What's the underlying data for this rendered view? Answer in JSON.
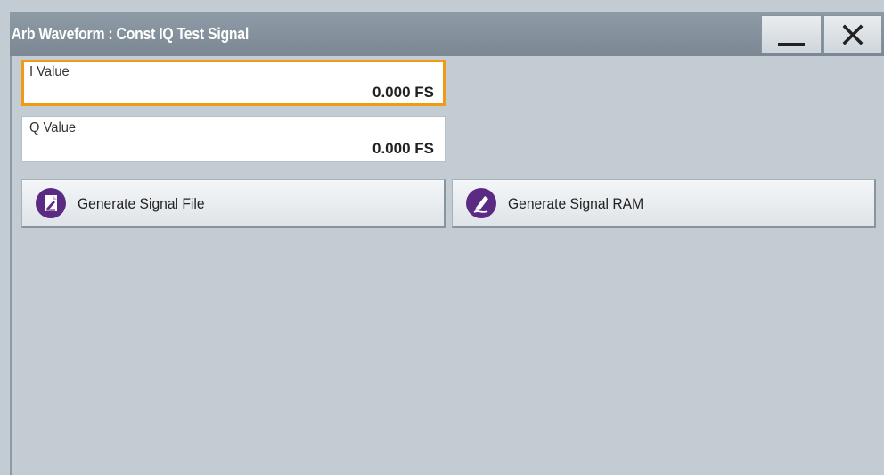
{
  "window": {
    "title": "Arb Waveform : Const IQ Test Signal"
  },
  "fields": {
    "i_value": {
      "label": "I Value",
      "value": "0.000 FS"
    },
    "q_value": {
      "label": "Q Value",
      "value": "0.000 FS"
    }
  },
  "buttons": {
    "generate_file": {
      "label": "Generate Signal File",
      "icon": "file-edit-icon"
    },
    "generate_ram": {
      "label": "Generate Signal RAM",
      "icon": "pen-icon"
    }
  },
  "colors": {
    "focus_border": "#f09a15",
    "icon_background": "#5b2a83",
    "titlebar": "#8491a0",
    "panel": "#c3ccd3"
  }
}
